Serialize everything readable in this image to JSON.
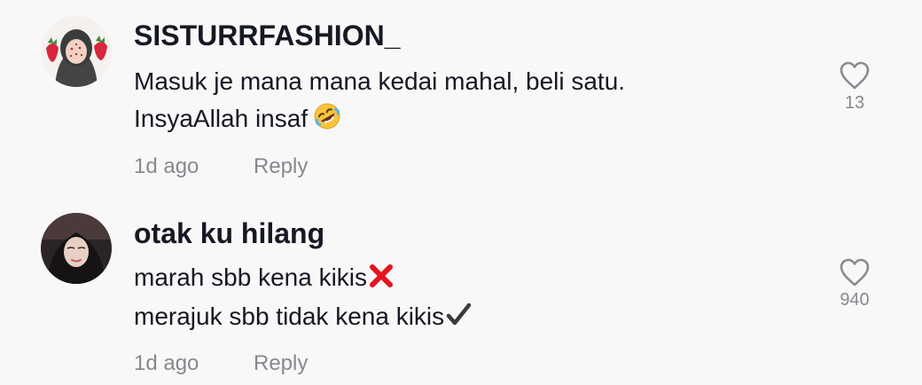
{
  "comments": [
    {
      "username": "SISTURRFASHION_",
      "lines": [
        "Masuk je mana mana kedai mahal, beli satu.",
        "InsyaAllah insaf"
      ],
      "line2_emoji": "rolling-on-floor-laughing",
      "time": "1d ago",
      "reply_label": "Reply",
      "like_count": "13"
    },
    {
      "username": "otak ku hilang",
      "lines": [
        "marah sbb kena kikis",
        "merajuk sbb tidak kena kikis"
      ],
      "line1_emoji": "cross-mark",
      "line2_emoji": "check-mark",
      "time": "1d ago",
      "reply_label": "Reply",
      "like_count": "940"
    }
  ],
  "colors": {
    "background": "#f8f8f8",
    "text_primary": "#161823",
    "text_secondary": "rgba(22,24,35,0.5)",
    "cross": "#e3141f"
  }
}
